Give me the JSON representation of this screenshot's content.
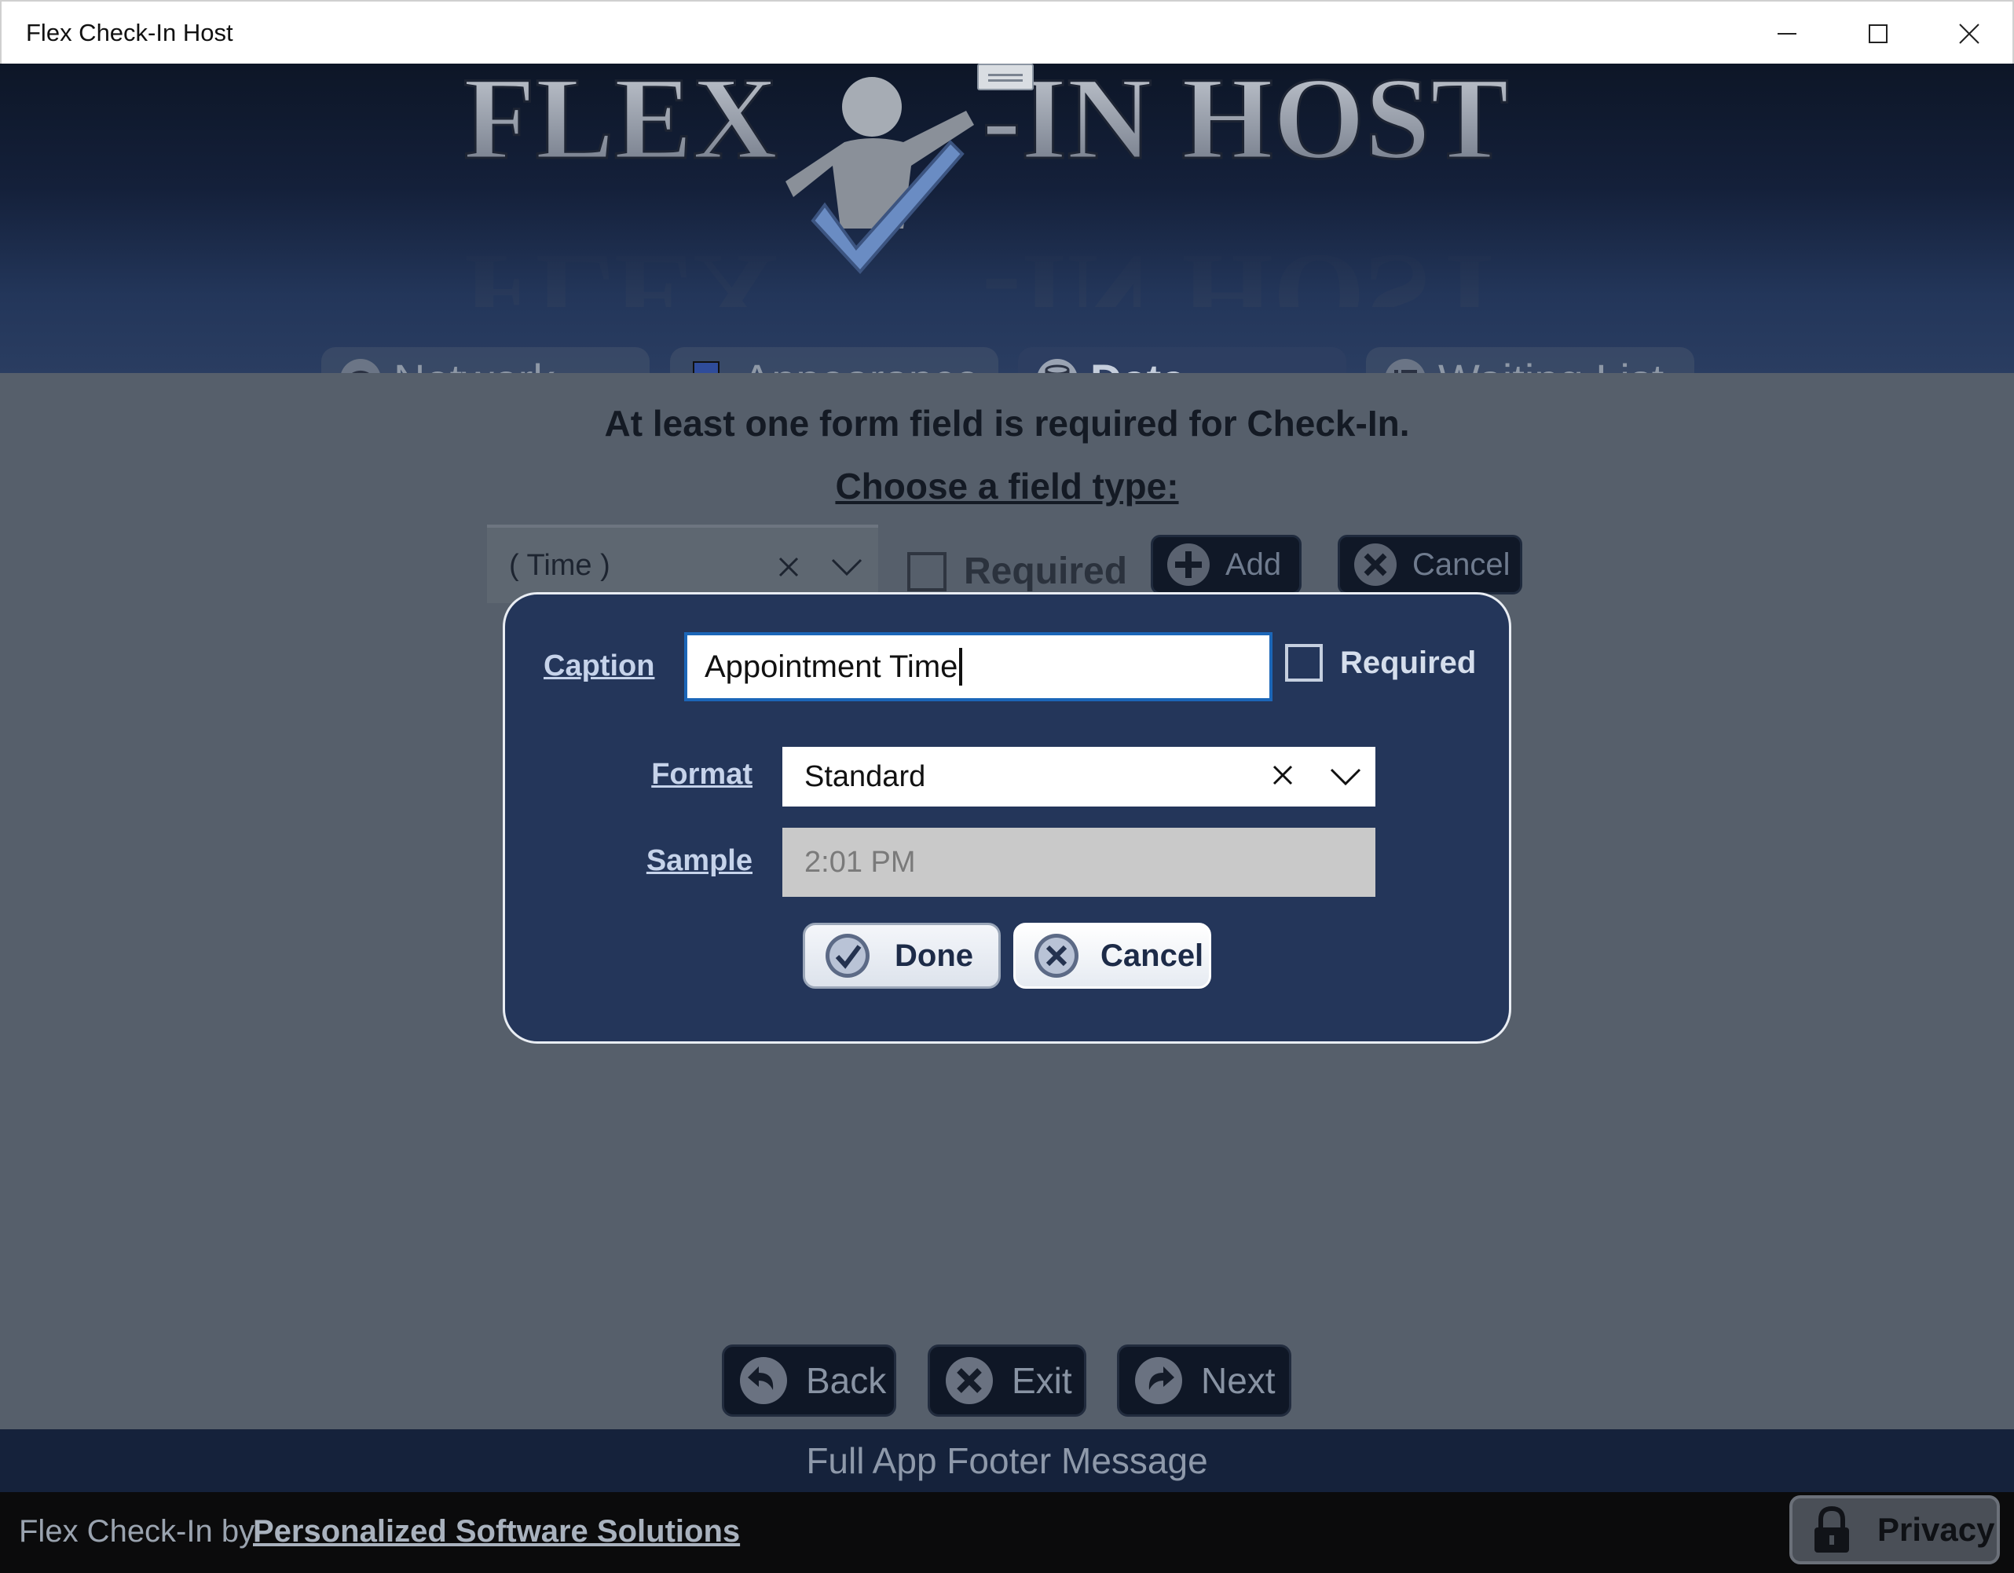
{
  "window": {
    "title": "Flex Check-In Host"
  },
  "header": {
    "logo_text": "FLEX CHECK-IN HOST",
    "logo_left": "FLEX",
    "logo_right": "-IN HOST"
  },
  "tabs": [
    {
      "label": "Network",
      "icon": "wifi-icon",
      "active": false
    },
    {
      "label": "Appearance",
      "icon": "monitor-icon",
      "active": false
    },
    {
      "label": "Data",
      "icon": "database-icon",
      "active": true
    },
    {
      "label": "Waiting List",
      "icon": "list-icon",
      "active": false
    }
  ],
  "content": {
    "required_message": "At least one form field is required for Check-In.",
    "choose_label": "Choose a field type:",
    "field_type_value": "( Time )",
    "required_label": "Required",
    "add_label": "Add",
    "cancel_label": "Cancel"
  },
  "dialog": {
    "caption_label": "Caption",
    "caption_value": "Appointment Time",
    "required_label": "Required",
    "format_label": "Format",
    "format_value": "Standard",
    "sample_label": "Sample",
    "sample_value": "2:01 PM",
    "done_label": "Done",
    "cancel_label": "Cancel"
  },
  "nav": {
    "back_label": "Back",
    "exit_label": "Exit",
    "next_label": "Next"
  },
  "footer": {
    "message": "Full App Footer Message",
    "credit_prefix": "Flex Check-In by",
    "credit_link": "Personalized Software Solutions",
    "privacy_label": "Privacy"
  },
  "colors": {
    "dialog_bg": "#24365a",
    "header_dark": "#0d1627",
    "content_bg": "#565f6b",
    "input_focus": "#1b66b8"
  }
}
